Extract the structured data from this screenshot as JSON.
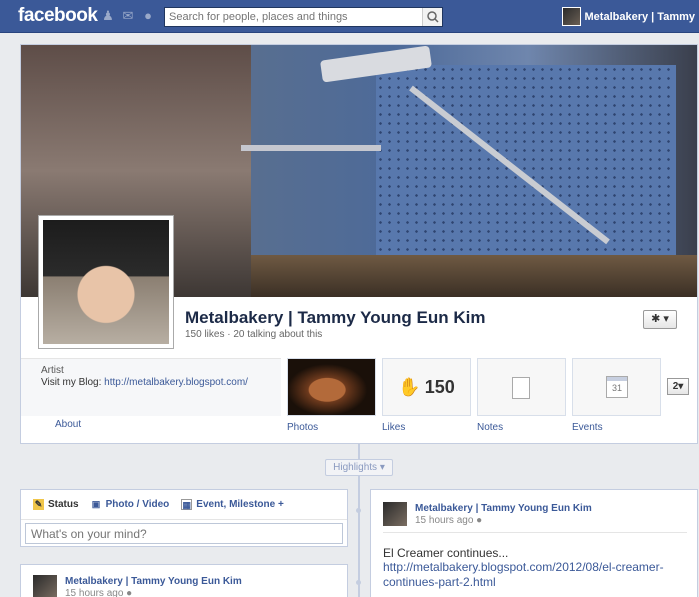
{
  "topbar": {
    "logo": "facebook",
    "search_placeholder": "Search for people, places and things",
    "user_label": "Metalbakery | Tammy"
  },
  "page": {
    "name": "Metalbakery | Tammy Young Eun Kim",
    "stats": "150 likes · 20 talking about this",
    "category": "Artist",
    "blog_label": "Visit my Blog:",
    "blog_url": "http://metalbakery.blogspot.com/",
    "about_label": "About",
    "more_count": "2"
  },
  "apps": [
    {
      "label": "Photos"
    },
    {
      "label": "Likes",
      "count": "150"
    },
    {
      "label": "Notes"
    },
    {
      "label": "Events",
      "calendar_day": "31"
    }
  ],
  "timeline": {
    "highlights_label": "Highlights",
    "composer": {
      "tabs": [
        "Status",
        "Photo / Video",
        "Event, Milestone +"
      ],
      "placeholder": "What's on your mind?"
    },
    "posts": [
      {
        "author": "Metalbakery | Tammy Young Eun Kim",
        "time": "15 hours ago",
        "text": "El Creamer continues...",
        "link": "http://metalbakery.blogspot.com/2012/08/el-creamer-continues-part-2.html"
      },
      {
        "author": "Metalbakery | Tammy Young Eun Kim",
        "time": "15 hours ago"
      }
    ]
  },
  "colors": {
    "brand": "#3b5998",
    "link": "#3b5998",
    "border": "#c4cde0"
  },
  "icons": {
    "friends": "friends-icon",
    "messages": "messages-icon",
    "notifications": "globe-icon",
    "search": "search-icon",
    "gear": "gear-icon",
    "like": "thumbs-up-icon"
  }
}
